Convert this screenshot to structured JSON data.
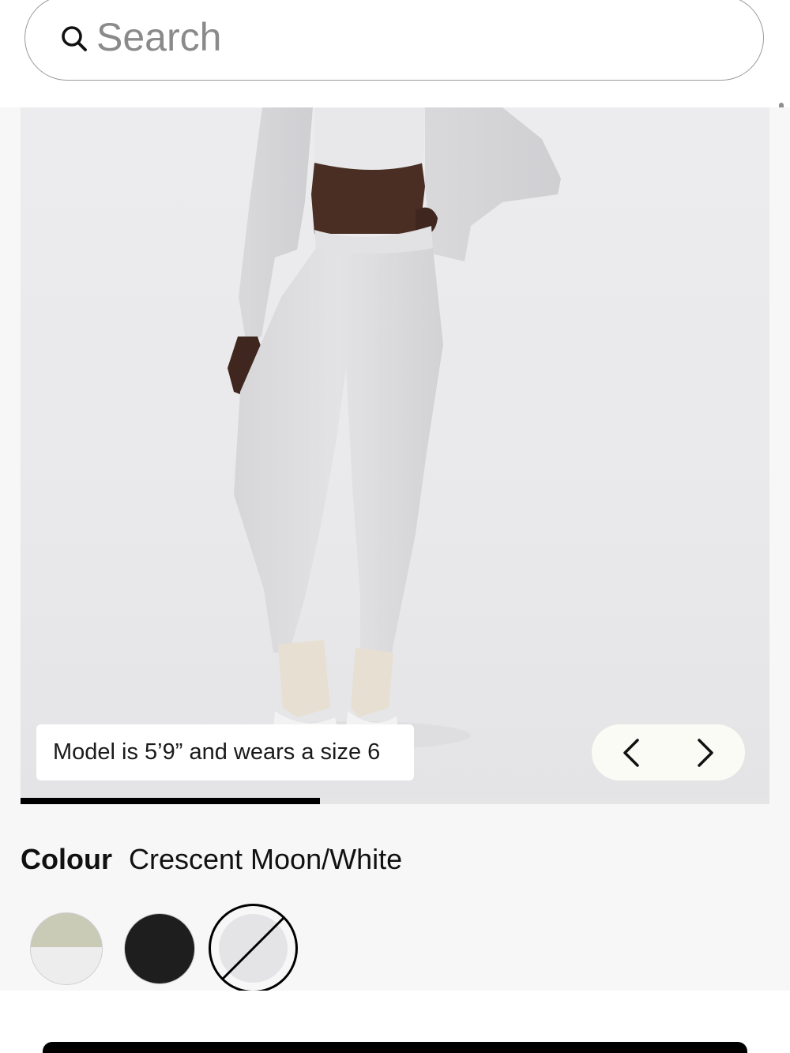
{
  "search": {
    "placeholder": "Search"
  },
  "gallery": {
    "caption": "Model is 5’9” and wears a size 6",
    "progress_fraction": 0.4
  },
  "colour": {
    "label": "Colour",
    "selected": "Crescent Moon/White",
    "swatches": [
      {
        "name": "two-tone",
        "top": "#c9cbb6",
        "bottom": "#ededee"
      },
      {
        "name": "black",
        "color": "#1e1e1e"
      },
      {
        "name": "crescent-moon-white",
        "color": "#e4e4e6",
        "selected": true,
        "unavailable": true
      }
    ]
  },
  "colors": {
    "accent": "#000000",
    "background": "#f7f7f7"
  }
}
